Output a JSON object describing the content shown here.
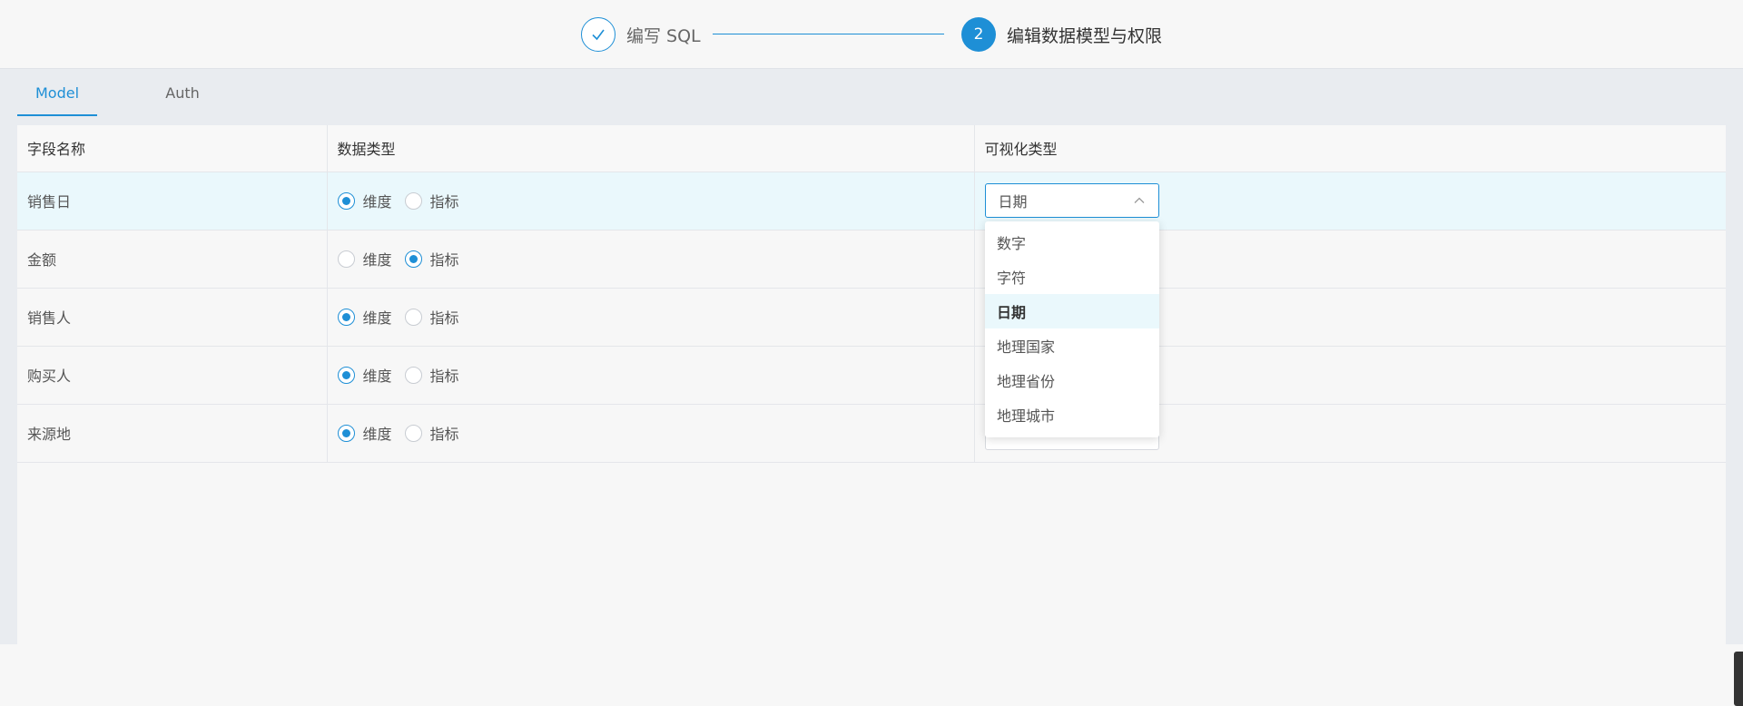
{
  "steps": [
    {
      "title": "编写 SQL",
      "state": "done"
    },
    {
      "number": "2",
      "title": "编辑数据模型与权限",
      "state": "active"
    }
  ],
  "tabs": [
    {
      "label": "Model",
      "active": true
    },
    {
      "label": "Auth",
      "active": false
    }
  ],
  "table": {
    "headers": [
      "字段名称",
      "数据类型",
      "可视化类型"
    ],
    "dimension_label": "维度",
    "metric_label": "指标",
    "rows": [
      {
        "name": "销售日",
        "data_type": "dimension",
        "visual_type": "日期"
      },
      {
        "name": "金额",
        "data_type": "metric",
        "visual_type": ""
      },
      {
        "name": "销售人",
        "data_type": "dimension",
        "visual_type": ""
      },
      {
        "name": "购买人",
        "data_type": "dimension",
        "visual_type": ""
      },
      {
        "name": "来源地",
        "data_type": "dimension",
        "visual_type": ""
      }
    ]
  },
  "dropdown": {
    "options": [
      "数字",
      "字符",
      "日期",
      "地理国家",
      "地理省份",
      "地理城市"
    ],
    "selected": "日期"
  },
  "colors": {
    "accent": "#1e8fd6",
    "row_highlight": "#eaf8fc"
  },
  "icons": {
    "step_done": "check-icon",
    "select": "chevron-up-icon"
  }
}
